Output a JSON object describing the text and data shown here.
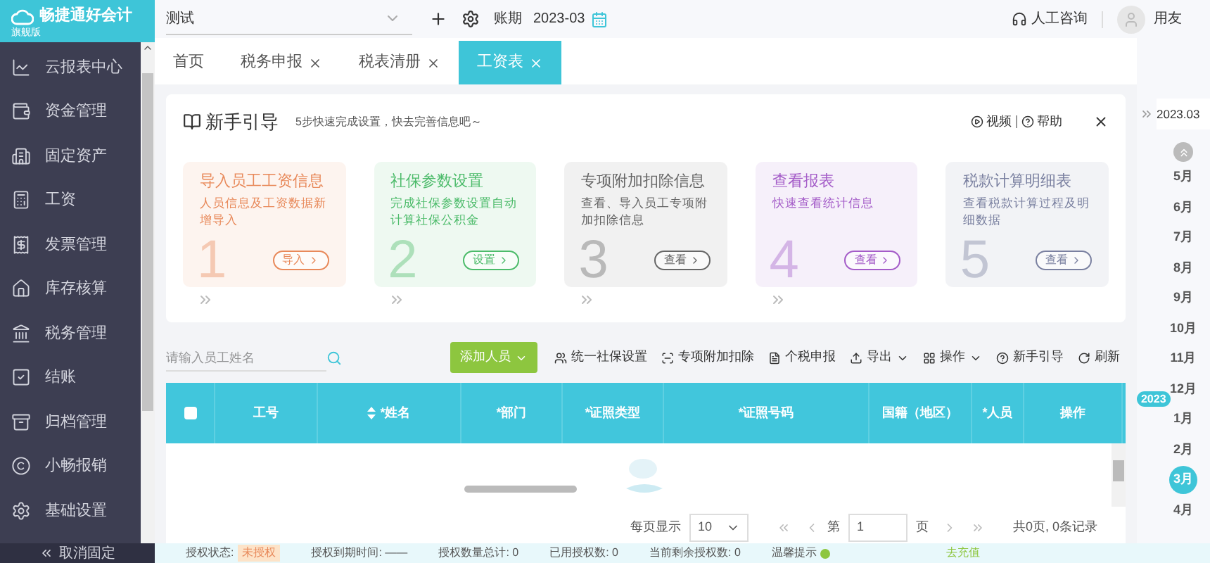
{
  "app": {
    "logo": "畅捷通好会计",
    "edition": "旗舰版"
  },
  "sidebar": {
    "items": [
      {
        "label": "云报表中心"
      },
      {
        "label": "资金管理"
      },
      {
        "label": "固定资产"
      },
      {
        "label": "工资"
      },
      {
        "label": "发票管理"
      },
      {
        "label": "库存核算"
      },
      {
        "label": "税务管理"
      },
      {
        "label": "结账"
      },
      {
        "label": "归档管理"
      },
      {
        "label": "小畅报销"
      },
      {
        "label": "基础设置"
      }
    ],
    "unpin": "取消固定"
  },
  "topbar": {
    "account": "测试",
    "period_label": "账期",
    "period": "2023-03",
    "support": "人工咨询",
    "user": "用友"
  },
  "tabs": [
    {
      "label": "首页",
      "closable": false,
      "selected": false
    },
    {
      "label": "税务申报",
      "closable": true,
      "selected": false
    },
    {
      "label": "税表清册",
      "closable": true,
      "selected": false
    },
    {
      "label": "工资表",
      "closable": true,
      "selected": true
    }
  ],
  "guide": {
    "title": "新手引导",
    "subtitle": "5步快速完成设置，快去完善信息吧～",
    "video": "视频",
    "help": "帮助",
    "steps": [
      {
        "number": "1",
        "title": "导入员工工资信息",
        "desc": "人员信息及工资数据新增导入",
        "button": "导入",
        "color": "#e8895a"
      },
      {
        "number": "2",
        "title": "社保参数设置",
        "desc": "完成社保参数设置自动计算社保公积金",
        "button": "设置",
        "color": "#4cbb6a"
      },
      {
        "number": "3",
        "title": "专项附加扣除信息",
        "desc": "查看、导入员工专项附加扣除信息",
        "button": "查看",
        "color": "#666666"
      },
      {
        "number": "4",
        "title": "查看报表",
        "desc": "快速查看统计信息",
        "button": "查看",
        "color": "#a45cc8"
      },
      {
        "number": "5",
        "title": "税款计算明细表",
        "desc": "查看税款计算过程及明细数据",
        "button": "查看",
        "color": "#7a80a0"
      }
    ]
  },
  "toolbar": {
    "search_placeholder": "请输入员工姓名",
    "add_button": "添加人员",
    "actions": [
      {
        "label": "统一社保设置",
        "dropdown": false
      },
      {
        "label": "专项附加扣除",
        "dropdown": false
      },
      {
        "label": "个税申报",
        "dropdown": false
      },
      {
        "label": "导出",
        "dropdown": true
      },
      {
        "label": "操作",
        "dropdown": true
      },
      {
        "label": "新手引导",
        "dropdown": false
      },
      {
        "label": "刷新",
        "dropdown": false
      }
    ]
  },
  "table": {
    "select_all": {
      "checked": false
    },
    "columns": [
      "工号",
      "*姓名",
      "*部门",
      "*证照类型",
      "*证照号码",
      "国籍（地区）",
      "*人员",
      "操作"
    ]
  },
  "pagination": {
    "per_page_label": "每页显示",
    "per_page": "10",
    "page_prefix": "第",
    "page": "1",
    "page_suffix": "页",
    "total": "共0页, 0条记录"
  },
  "status_bar": {
    "auth_label": "授权状态:",
    "auth_status": "未授权",
    "expiry": "授权到期时间: ——",
    "total": "授权数量总计: 0",
    "used": "已用授权数: 0",
    "remaining": "当前剩余授权数: 0",
    "tip": "温馨提示",
    "recharge": "去充值"
  },
  "timeline": {
    "current": "2023.03",
    "year": "2023",
    "months": [
      {
        "label": "5月",
        "selected": false
      },
      {
        "label": "6月",
        "selected": false
      },
      {
        "label": "7月",
        "selected": false
      },
      {
        "label": "8月",
        "selected": false
      },
      {
        "label": "9月",
        "selected": false
      },
      {
        "label": "10月",
        "selected": false
      },
      {
        "label": "11月",
        "selected": false
      },
      {
        "label": "12月",
        "selected": false
      },
      {
        "label": "1月",
        "selected": false
      },
      {
        "label": "2月",
        "selected": false
      },
      {
        "label": "3月",
        "selected": true
      },
      {
        "label": "4月",
        "selected": false
      }
    ]
  }
}
